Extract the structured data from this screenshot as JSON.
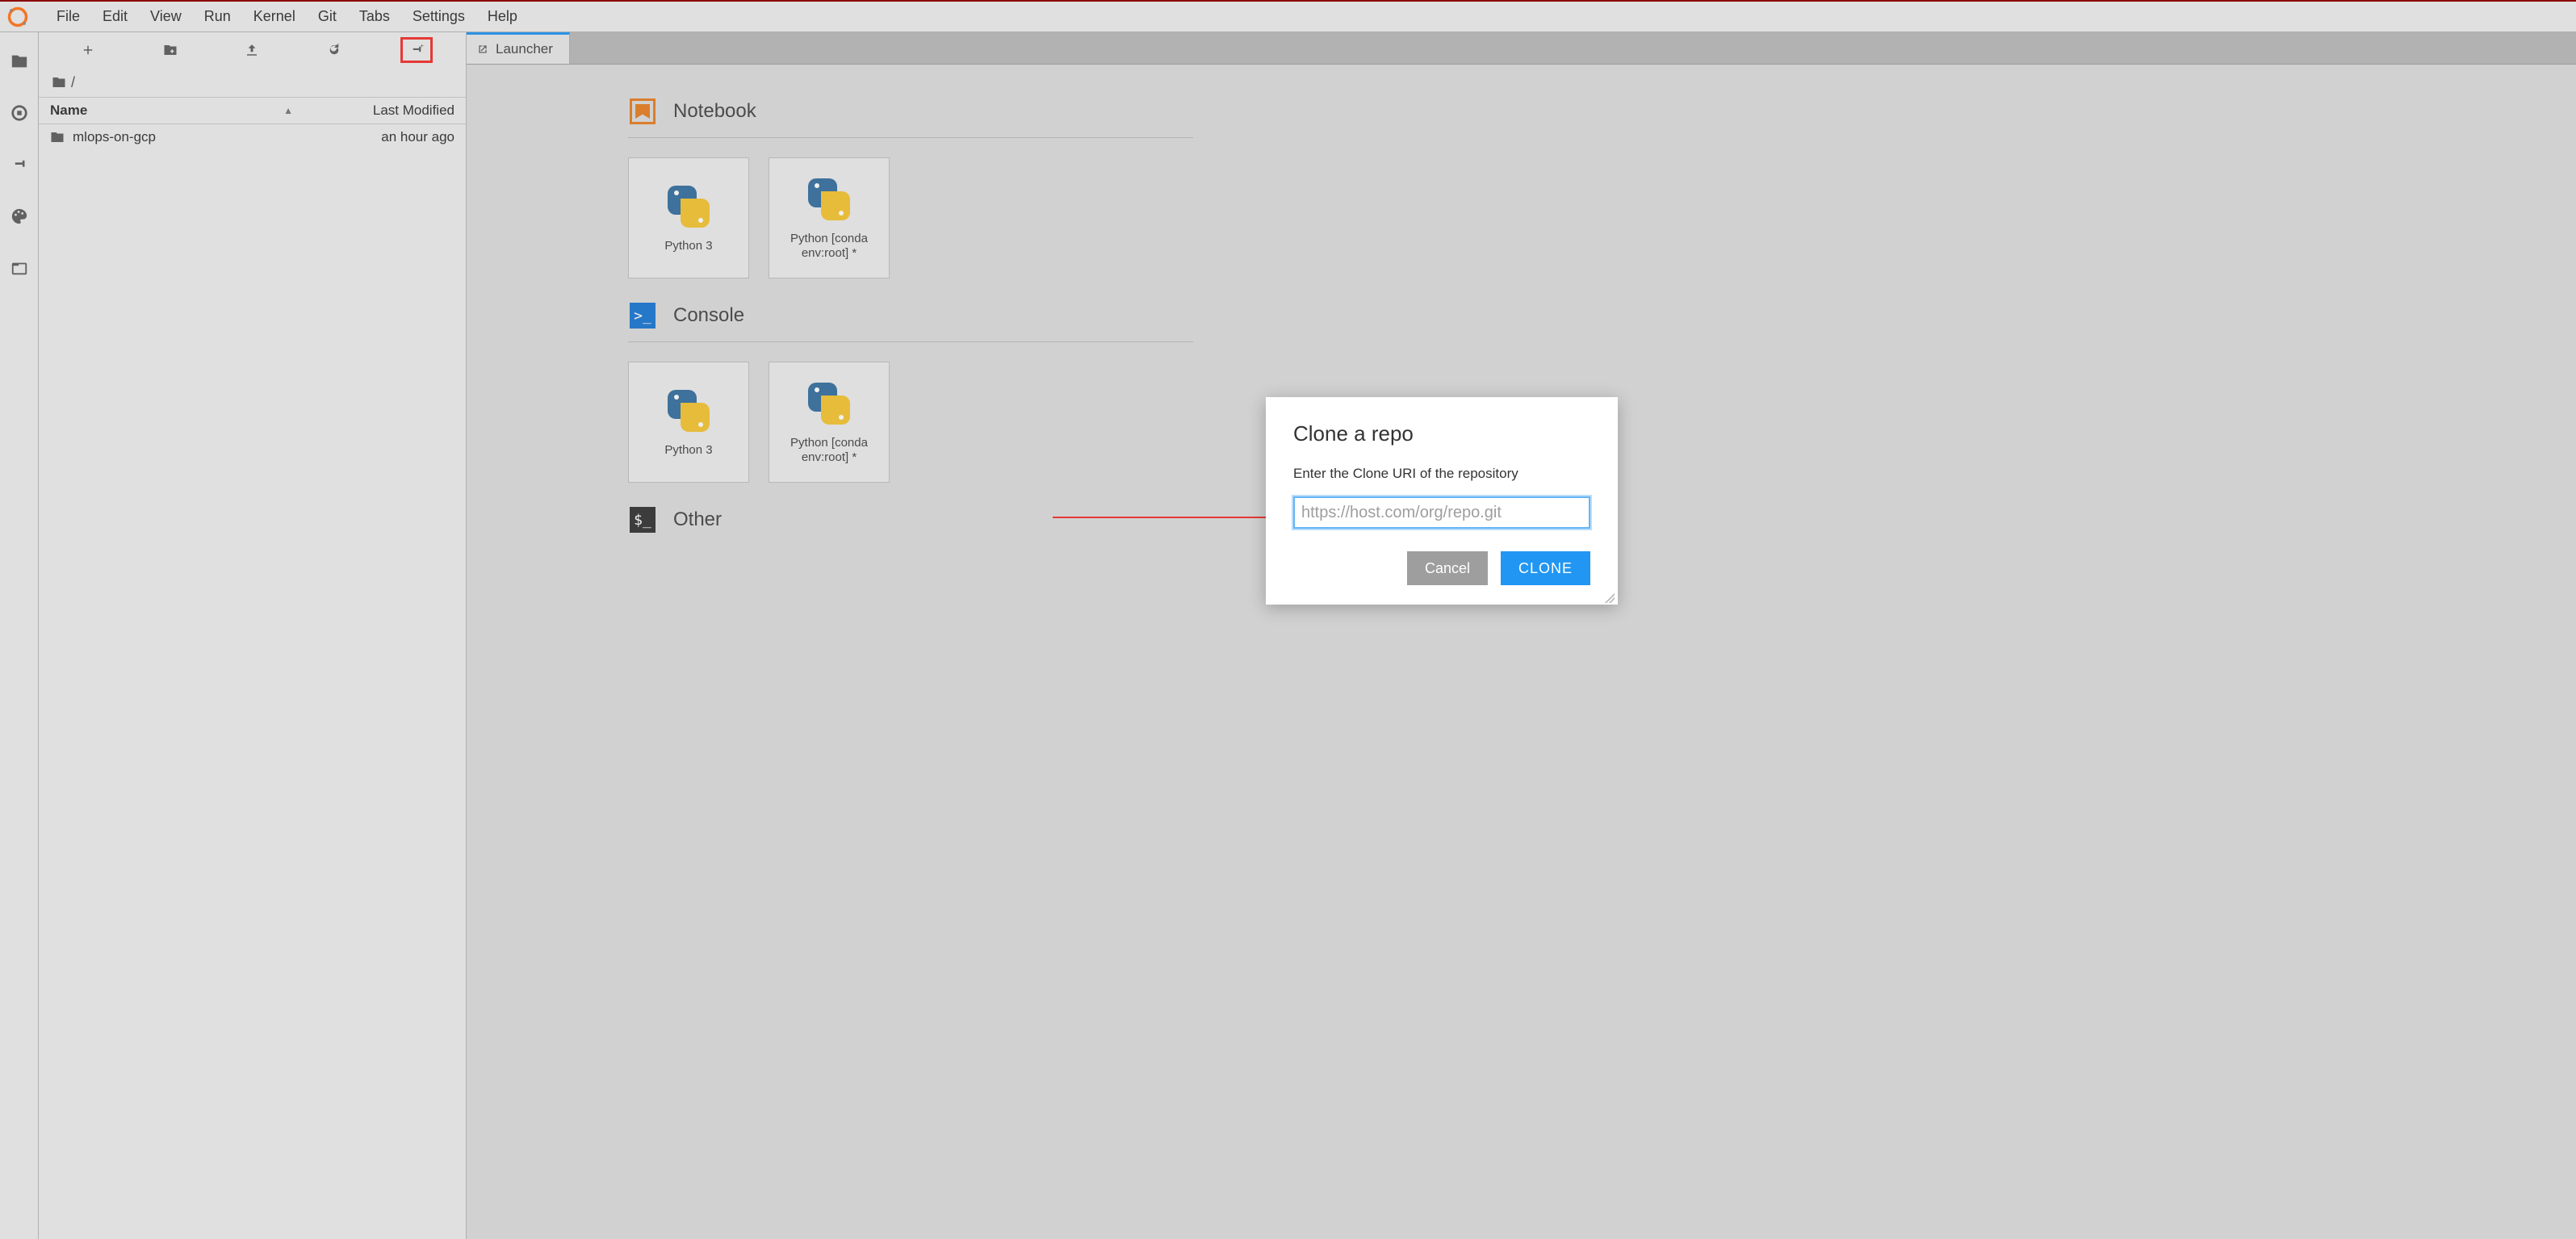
{
  "menu": [
    "File",
    "Edit",
    "View",
    "Run",
    "Kernel",
    "Git",
    "Tabs",
    "Settings",
    "Help"
  ],
  "breadcrumb": "/",
  "file_header": {
    "name": "Name",
    "modified": "Last Modified"
  },
  "files": [
    {
      "name": "mlops-on-gcp",
      "modified": "an hour ago"
    }
  ],
  "tab": {
    "label": "Launcher"
  },
  "launcher": {
    "sections": [
      {
        "title": "Notebook",
        "cards": [
          "Python 3",
          "Python [conda env:root] *"
        ]
      },
      {
        "title": "Console",
        "cards": [
          "Python 3",
          "Python [conda env:root] *"
        ]
      },
      {
        "title": "Other",
        "cards": []
      }
    ]
  },
  "dialog": {
    "title": "Clone a repo",
    "prompt": "Enter the Clone URI of the repository",
    "placeholder": "https://host.com/org/repo.git",
    "cancel": "Cancel",
    "clone": "CLONE"
  }
}
